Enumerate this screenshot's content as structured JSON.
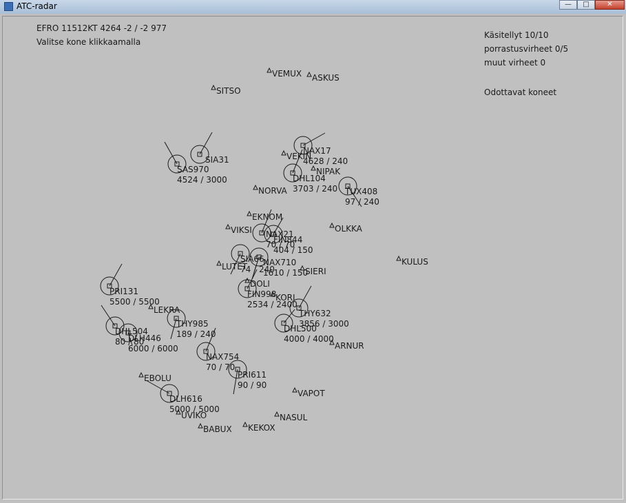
{
  "window": {
    "title": "ATC-radar",
    "minimize_glyph": "—",
    "maximize_glyph": "□",
    "close_glyph": "✕"
  },
  "info": {
    "weather_line": "EFRO 11512KT 4264 -2 / -2 977",
    "instruction": "Valitse kone klikkaamalla"
  },
  "status": {
    "handled": "Käsitellyt 10/10",
    "separation_errors": "porrastusvirheet 0/5",
    "other_errors": "muut virheet 0",
    "waiting_header": "Odottavat koneet"
  },
  "colors": {
    "background": "#c0c0c0",
    "symbols": "#1a1a1a"
  },
  "waypoints": [
    {
      "name": "VEMUX"
    },
    {
      "name": "ASKUS"
    },
    {
      "name": "SITSO"
    },
    {
      "name": "VEKIN"
    },
    {
      "name": "NIPAK"
    },
    {
      "name": "NORVA"
    },
    {
      "name": "EKNOM"
    },
    {
      "name": "VIKSI"
    },
    {
      "name": "OLKKA"
    },
    {
      "name": "KULUS"
    },
    {
      "name": "LUTET"
    },
    {
      "name": "SIERI"
    },
    {
      "name": "DOLI"
    },
    {
      "name": "KORI"
    },
    {
      "name": "LEKRA"
    },
    {
      "name": "ARNUR"
    },
    {
      "name": "EBOLU"
    },
    {
      "name": "VAPOT"
    },
    {
      "name": "UVIKO"
    },
    {
      "name": "NASUL"
    },
    {
      "name": "BABUX"
    },
    {
      "name": "KEKOX"
    }
  ],
  "aircraft": [
    {
      "callsign": "SIA31",
      "data": ""
    },
    {
      "callsign": "SAS970",
      "data": "4524 / 3000"
    },
    {
      "callsign": "NAX17",
      "data": "4628 / 240"
    },
    {
      "callsign": "DHL104",
      "data": "3703 / 240"
    },
    {
      "callsign": "TUX408",
      "data": "97 / 240"
    },
    {
      "callsign": "NAX21",
      "data": "70 / 70"
    },
    {
      "callsign": "FIN844",
      "data": "404 / 150"
    },
    {
      "callsign": "SIA66",
      "data": "74 / 240"
    },
    {
      "callsign": "NAX710",
      "data": "1610 / 150"
    },
    {
      "callsign": "PRI131",
      "data": "5500 / 5500"
    },
    {
      "callsign": "FIN998",
      "data": "2534 / 2400"
    },
    {
      "callsign": "THY632",
      "data": "3856 / 3000"
    },
    {
      "callsign": "DHL500",
      "data": "4000 / 4000"
    },
    {
      "callsign": "THY985",
      "data": "189 / 240"
    },
    {
      "callsign": "DHL504",
      "data": "80 / 80"
    },
    {
      "callsign": "DLH446",
      "data": "6000 / 6000"
    },
    {
      "callsign": "NAX754",
      "data": "70 / 70"
    },
    {
      "callsign": "PRI611",
      "data": "90 / 90"
    },
    {
      "callsign": "DLH616",
      "data": "5000 / 5000"
    }
  ]
}
